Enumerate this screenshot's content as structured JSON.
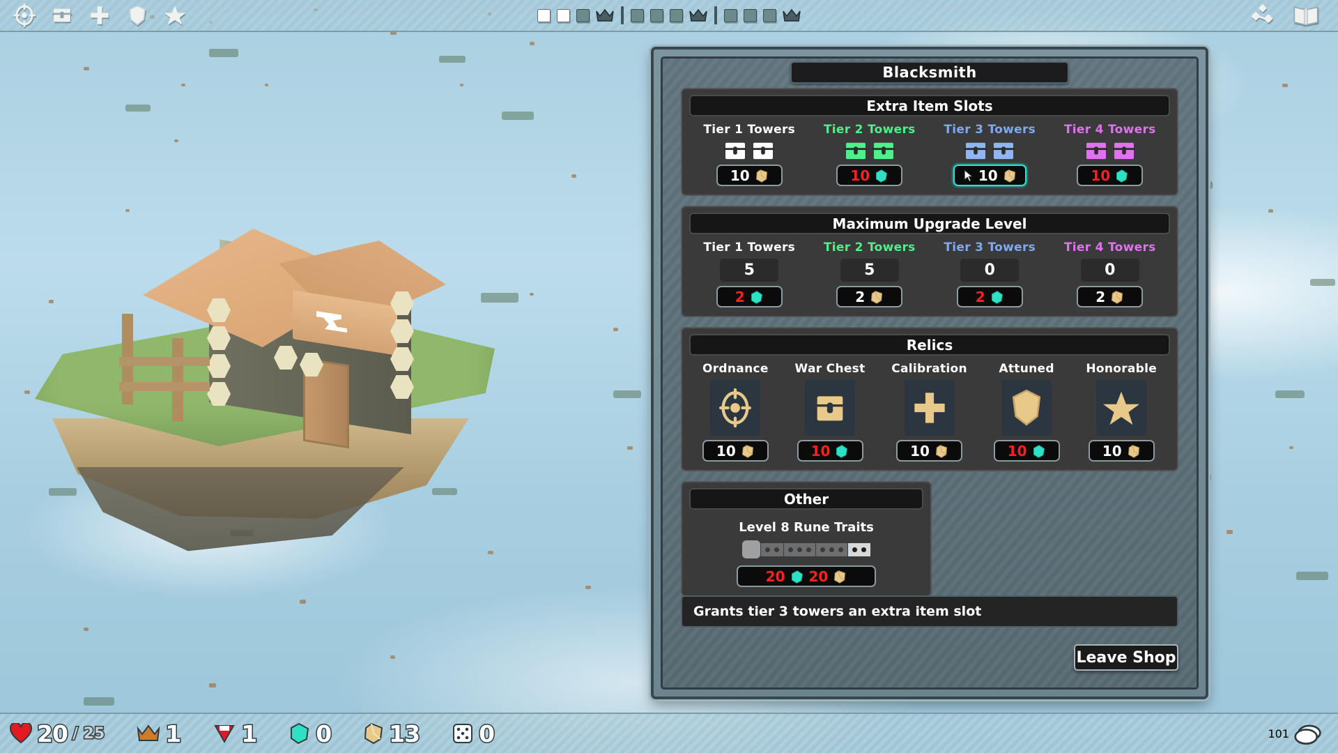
{
  "shop": {
    "title": "Blacksmith",
    "tooltip": "Grants tier 3 towers an extra item slot",
    "leave_label": "Leave Shop",
    "sections": {
      "extra_item_slots": {
        "header": "Extra Item Slots",
        "columns": [
          {
            "label": "Tier 1 Towers",
            "tier": 1,
            "chest_color": "#ffffff",
            "chests": 2,
            "price": "10",
            "currency": "wood",
            "affordable": true,
            "selected": false
          },
          {
            "label": "Tier 2 Towers",
            "tier": 2,
            "chest_color": "#4ef08a",
            "chests": 2,
            "price": "10",
            "currency": "gem",
            "affordable": false,
            "selected": false
          },
          {
            "label": "Tier 3 Towers",
            "tier": 3,
            "chest_color": "#8fb6f2",
            "chests": 2,
            "price": "10",
            "currency": "wood",
            "affordable": true,
            "selected": true
          },
          {
            "label": "Tier 4 Towers",
            "tier": 4,
            "chest_color": "#e072f0",
            "chests": 2,
            "price": "10",
            "currency": "gem",
            "affordable": false,
            "selected": false
          }
        ]
      },
      "maximum_upgrade_level": {
        "header": "Maximum Upgrade Level",
        "columns": [
          {
            "label": "Tier 1 Towers",
            "tier": 1,
            "level": "5",
            "price": "2",
            "currency": "gem",
            "affordable": false
          },
          {
            "label": "Tier 2 Towers",
            "tier": 2,
            "level": "5",
            "price": "2",
            "currency": "wood",
            "affordable": true
          },
          {
            "label": "Tier 3 Towers",
            "tier": 3,
            "level": "0",
            "price": "2",
            "currency": "gem",
            "affordable": false
          },
          {
            "label": "Tier 4 Towers",
            "tier": 4,
            "level": "0",
            "price": "2",
            "currency": "wood",
            "affordable": true
          }
        ]
      },
      "relics": {
        "header": "Relics",
        "columns": [
          {
            "label": "Ordnance",
            "icon": "crosshair-icon",
            "price": "10",
            "currency": "wood",
            "affordable": true
          },
          {
            "label": "War Chest",
            "icon": "chest-icon",
            "price": "10",
            "currency": "gem",
            "affordable": false
          },
          {
            "label": "Calibration",
            "icon": "plus-icon",
            "price": "10",
            "currency": "wood",
            "affordable": true
          },
          {
            "label": "Attuned",
            "icon": "shield-icon",
            "price": "10",
            "currency": "gem",
            "affordable": false
          },
          {
            "label": "Honorable",
            "icon": "star-icon",
            "price": "10",
            "currency": "wood",
            "affordable": true
          }
        ]
      },
      "other": {
        "header": "Other",
        "rune_label": "Level 8 Rune Traits",
        "rune_segments": [
          {
            "style": "dark",
            "dots": 2
          },
          {
            "style": "dark",
            "dots": 3
          },
          {
            "style": "dark",
            "dots": 3
          },
          {
            "style": "light",
            "dots": 2
          }
        ],
        "price_gem": "20",
        "price_wood": "20",
        "gem_affordable": false,
        "wood_affordable": false
      }
    }
  },
  "topbar": {
    "icons": [
      "crosshair-icon",
      "chest-icon",
      "plus-icon",
      "shield-icon",
      "star-icon"
    ],
    "wave_groups": [
      {
        "boxes": [
          "full",
          "full",
          "empty"
        ],
        "crown": true
      },
      {
        "boxes": [
          "empty",
          "empty",
          "empty"
        ],
        "crown": true
      },
      {
        "boxes": [
          "empty",
          "empty",
          "empty"
        ],
        "crown": true
      }
    ],
    "right_icons": [
      "skill-tree-icon",
      "book-icon"
    ]
  },
  "bottombar": {
    "stats": [
      {
        "name": "health",
        "icon": "heart-icon",
        "value": "20",
        "max": "/ 25"
      },
      {
        "name": "crown",
        "icon": "crown-icon",
        "value": "1",
        "max": ""
      },
      {
        "name": "ruby",
        "icon": "ruby-icon",
        "value": "1",
        "max": ""
      },
      {
        "name": "gem",
        "icon": "gem-icon",
        "value": "0",
        "max": ""
      },
      {
        "name": "wood",
        "icon": "wood-icon",
        "value": "13",
        "max": ""
      },
      {
        "name": "dice",
        "icon": "dice-icon",
        "value": "0",
        "max": ""
      }
    ],
    "coins": {
      "icon": "coin-icon",
      "value": "101"
    }
  },
  "colors": {
    "gem": "#2ee0c4",
    "wood": "#e8c98a",
    "red": "#ff2020",
    "accent": "#25e6d0"
  }
}
